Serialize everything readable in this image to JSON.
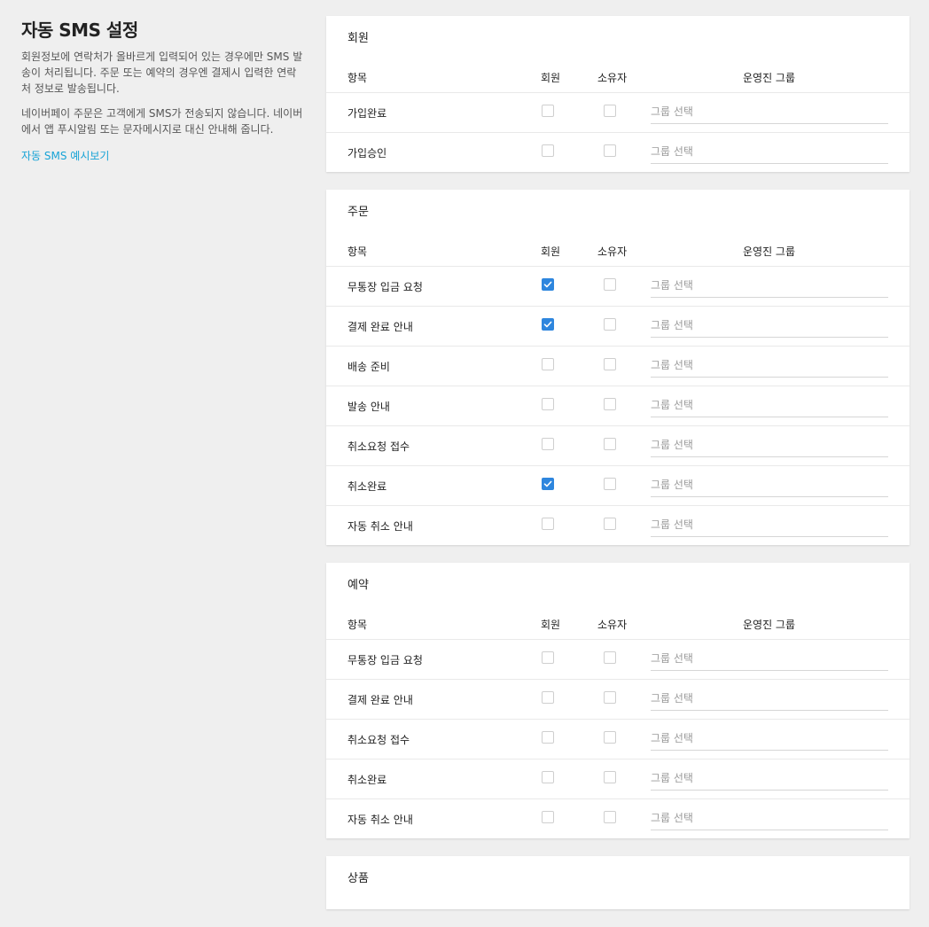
{
  "page": {
    "title": "자동 SMS 설정",
    "desc1": "회원정보에 연락처가 올바르게 입력되어 있는 경우에만 SMS 발송이 처리됩니다. 주문 또는 예약의 경우엔 결제시 입력한 연락처 정보로 발송됩니다.",
    "desc2": "네이버페이 주문은 고객에게 SMS가 전송되지 않습니다. 네이버에서 앱 푸시알림 또는 문자메시지로 대신 안내해 줍니다.",
    "preview_link": "자동 SMS 예시보기"
  },
  "columns": {
    "item": "항목",
    "member": "회원",
    "owner": "소유자",
    "group": "운영진 그룹"
  },
  "group_placeholder": "그룹 선택",
  "colors": {
    "accent": "#2e86de",
    "link": "#17a3d6"
  },
  "sections": [
    {
      "title": "회원",
      "rows": [
        {
          "label": "가입완료",
          "member": false,
          "owner": false
        },
        {
          "label": "가입승인",
          "member": false,
          "owner": false
        }
      ]
    },
    {
      "title": "주문",
      "rows": [
        {
          "label": "무통장 입금 요청",
          "member": true,
          "owner": false
        },
        {
          "label": "결제 완료 안내",
          "member": true,
          "owner": false
        },
        {
          "label": "배송 준비",
          "member": false,
          "owner": false
        },
        {
          "label": "발송 안내",
          "member": false,
          "owner": false
        },
        {
          "label": "취소요청 접수",
          "member": false,
          "owner": false
        },
        {
          "label": "취소완료",
          "member": true,
          "owner": false
        },
        {
          "label": "자동 취소 안내",
          "member": false,
          "owner": false
        }
      ]
    },
    {
      "title": "예약",
      "rows": [
        {
          "label": "무통장 입금 요청",
          "member": false,
          "owner": false
        },
        {
          "label": "결제 완료 안내",
          "member": false,
          "owner": false
        },
        {
          "label": "취소요청 접수",
          "member": false,
          "owner": false
        },
        {
          "label": "취소완료",
          "member": false,
          "owner": false
        },
        {
          "label": "자동 취소 안내",
          "member": false,
          "owner": false
        }
      ]
    },
    {
      "title": "상품",
      "rows": []
    }
  ]
}
